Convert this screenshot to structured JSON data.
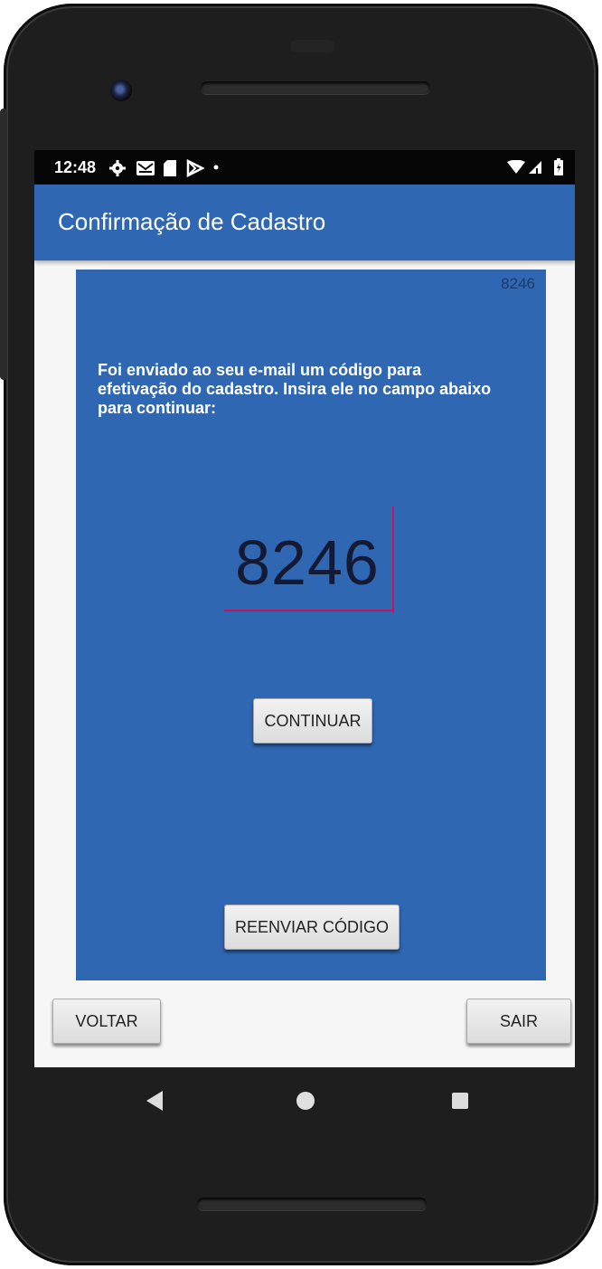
{
  "status_bar": {
    "time": "12:48",
    "left_icons": [
      "settings-icon",
      "gmail-icon",
      "sd-card-icon",
      "play-store-icon",
      "dot-icon"
    ],
    "right_icons": [
      "wifi-icon",
      "signal-icon",
      "battery-icon"
    ]
  },
  "app_bar": {
    "title": "Confirmação de Cadastro",
    "color": "#2f67b3"
  },
  "panel": {
    "corner_code": "8246",
    "message": "Foi enviado ao seu e-mail um código para efetivação do cadastro. Insira ele no campo abaixo para continuar:",
    "code_value": "8246",
    "accent_color": "#c2185b"
  },
  "buttons": {
    "continue_label": "CONTINUAR",
    "resend_label": "REENVIAR CÓDIGO",
    "back_label": "VOLTAR",
    "exit_label": "SAIR"
  },
  "nav_bar": {
    "icons": [
      "back-icon",
      "home-icon",
      "recents-icon"
    ]
  }
}
